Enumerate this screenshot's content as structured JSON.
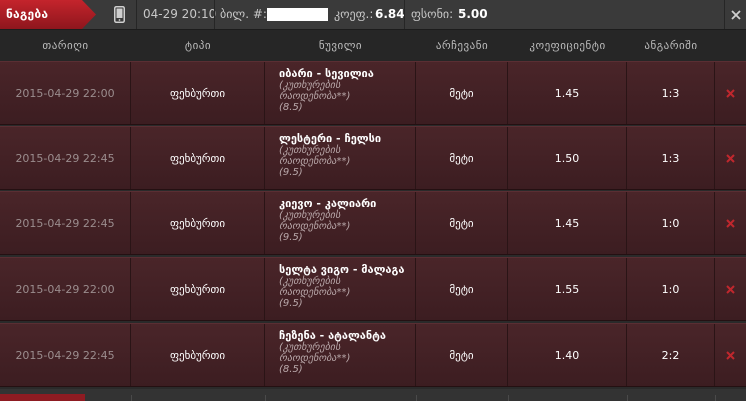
{
  "topbar": {
    "main_tab": "ნაგება",
    "datetime": "04-29 20:10",
    "ticket_label": "ბილ. #:",
    "coef_label": "კოეფ.:",
    "coef_value": "6.84",
    "stake_label": "ფსონი:",
    "stake_value": "5.00"
  },
  "colors": {
    "accent": "#b71c24",
    "row_bg": "#432126",
    "delete": "#c0272d"
  },
  "icons": {
    "phone": "mobile-phone-icon",
    "close": "close-icon",
    "delete": "delete-x-icon"
  },
  "table": {
    "headers": [
      "თარიღი",
      "ტიპი",
      "ნუვილი",
      "არჩევანი",
      "კოეფიციენტი",
      "ანგარიში"
    ],
    "rows": [
      {
        "date": "2015-04-29 22:00",
        "type": "ფეხბურთი",
        "event": "იბარი - სევილია",
        "market_line1": "(კუთხურების",
        "market_line2": "რაოდენობა**)",
        "line": "(8.5)",
        "choice": "მეტი",
        "odds": "1.45",
        "score": "1:3"
      },
      {
        "date": "2015-04-29 22:45",
        "type": "ფეხბურთი",
        "event": "ლესტერი - ჩელსი",
        "market_line1": "(კუთხურების",
        "market_line2": "რაოდენობა**)",
        "line": "(9.5)",
        "choice": "მეტი",
        "odds": "1.50",
        "score": "1:3"
      },
      {
        "date": "2015-04-29 22:45",
        "type": "ფეხბურთი",
        "event": "კიევო - კალიარი",
        "market_line1": "(კუთხურების",
        "market_line2": "რაოდენობა**)",
        "line": "(9.5)",
        "choice": "მეტი",
        "odds": "1.45",
        "score": "1:0"
      },
      {
        "date": "2015-04-29 22:00",
        "type": "ფეხბურთი",
        "event": "სელტა ვიგო - მალაგა",
        "market_line1": "(კუთხურების",
        "market_line2": "რაოდენობა**)",
        "line": "(9.5)",
        "choice": "მეტი",
        "odds": "1.55",
        "score": "1:0"
      },
      {
        "date": "2015-04-29 22:45",
        "type": "ფეხბურთი",
        "event": "ჩეზენა - ატალანტა",
        "market_line1": "(კუთხურების",
        "market_line2": "რაოდენობა**)",
        "line": "(8.5)",
        "choice": "მეტი",
        "odds": "1.40",
        "score": "2:2"
      }
    ]
  }
}
